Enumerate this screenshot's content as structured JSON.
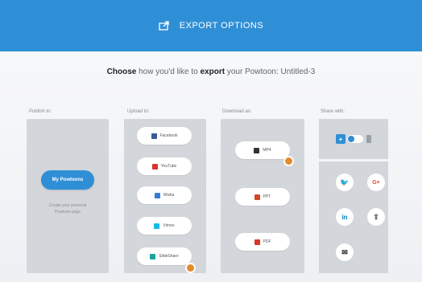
{
  "header": {
    "title": "EXPORT OPTIONS",
    "icon": "export-icon"
  },
  "subtitle": {
    "prefix": "Choose",
    "middle": " how you'd like to ",
    "bold2": "export",
    "suffix": " your Powtoon: Untitled-3"
  },
  "columns": {
    "publish": {
      "label": "Publish to:",
      "button": "My Powtoons",
      "note_line1": "Create your personal",
      "note_line2": "Powtoon page"
    },
    "upload": {
      "label": "Upload to:",
      "items": [
        {
          "label": "Facebook",
          "icon": "facebook-icon",
          "color": "#3b5998"
        },
        {
          "label": "YouTube",
          "icon": "youtube-icon",
          "color": "#d9342b"
        },
        {
          "label": "Wistia",
          "icon": "wistia-icon",
          "color": "#3a7bd5"
        },
        {
          "label": "Vimeo",
          "icon": "vimeo-icon",
          "color": "#1ab7ea"
        },
        {
          "label": "SlideShare",
          "icon": "slideshare-icon",
          "color": "#1ba39c"
        }
      ]
    },
    "download": {
      "label": "Download as:",
      "items": [
        {
          "label": "MP4",
          "icon": "film-icon",
          "color": "#333333"
        },
        {
          "label": "PPT",
          "icon": "powerpoint-icon",
          "color": "#d24726"
        },
        {
          "label": "PDF",
          "icon": "pdf-icon",
          "color": "#d9342b"
        }
      ]
    },
    "share": {
      "label": "Share with:",
      "items": [
        {
          "name": "twitter-icon",
          "glyph": "🐦",
          "color": "#1da1f2"
        },
        {
          "name": "google-plus-icon",
          "glyph": "G+",
          "color": "#dd4b39"
        },
        {
          "name": "linkedin-icon",
          "glyph": "in",
          "color": "#0077b5"
        },
        {
          "name": "share-link-icon",
          "glyph": "⇪",
          "color": "#444444"
        },
        {
          "name": "email-icon",
          "glyph": "✉",
          "color": "#222222"
        }
      ]
    }
  },
  "colors": {
    "accent": "#2f8fd6",
    "panel": "#d3d6da",
    "badge": "#e38a2b"
  }
}
